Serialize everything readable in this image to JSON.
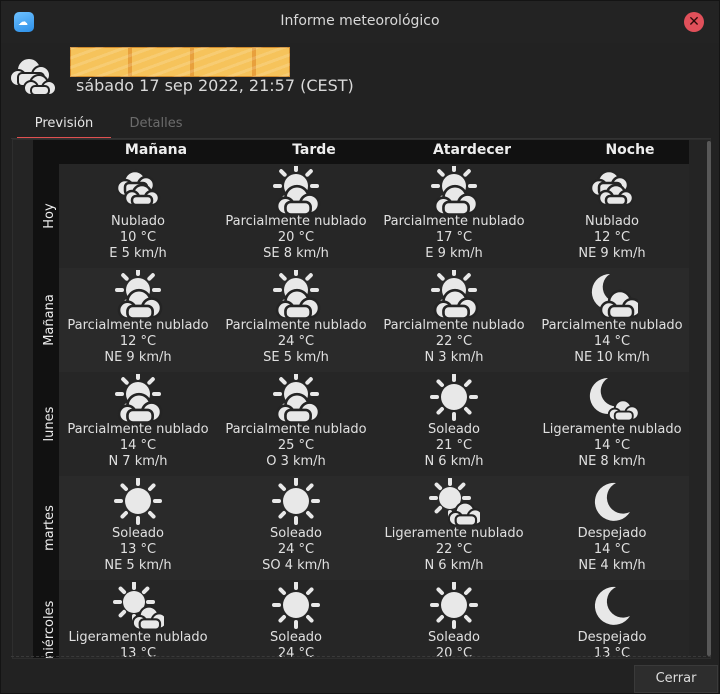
{
  "window": {
    "title": "Informe meteorológico",
    "close_symbol": "✕"
  },
  "header": {
    "datetime": "sábado 17 sep 2022, 21:57 (CEST)",
    "icon": "cloudy-icon"
  },
  "tabs": [
    {
      "label": "Previsión",
      "active": true
    },
    {
      "label": "Detalles",
      "active": false
    }
  ],
  "forecast": {
    "columns": [
      "Mañana",
      "Tarde",
      "Atardecer",
      "Noche"
    ],
    "rows": [
      {
        "label": "Hoy",
        "cells": [
          {
            "icon": "cloud",
            "cond": "Nublado",
            "temp": "10 °C",
            "wind": "E 5 km/h"
          },
          {
            "icon": "sun-cloud",
            "cond": "Parcialmente nublado",
            "temp": "20 °C",
            "wind": "SE 8 km/h"
          },
          {
            "icon": "sun-cloud",
            "cond": "Parcialmente nublado",
            "temp": "17 °C",
            "wind": "E 9 km/h"
          },
          {
            "icon": "cloud",
            "cond": "Nublado",
            "temp": "12 °C",
            "wind": "NE 9 km/h"
          }
        ]
      },
      {
        "label": "Mañana",
        "cells": [
          {
            "icon": "sun-cloud",
            "cond": "Parcialmente nublado",
            "temp": "12 °C",
            "wind": "NE 9 km/h"
          },
          {
            "icon": "sun-cloud",
            "cond": "Parcialmente nublado",
            "temp": "24 °C",
            "wind": "SE 5 km/h"
          },
          {
            "icon": "sun-cloud",
            "cond": "Parcialmente nublado",
            "temp": "22 °C",
            "wind": "N 3 km/h"
          },
          {
            "icon": "moon-cloud",
            "cond": "Parcialmente nublado",
            "temp": "14 °C",
            "wind": "NE 10 km/h"
          }
        ]
      },
      {
        "label": "lunes",
        "cells": [
          {
            "icon": "sun-cloud",
            "cond": "Parcialmente nublado",
            "temp": "14 °C",
            "wind": "N 7 km/h"
          },
          {
            "icon": "sun-cloud",
            "cond": "Parcialmente nublado",
            "temp": "25 °C",
            "wind": "O 3 km/h"
          },
          {
            "icon": "sun",
            "cond": "Soleado",
            "temp": "21 °C",
            "wind": "N 6 km/h"
          },
          {
            "icon": "moon-small-cloud",
            "cond": "Ligeramente nublado",
            "temp": "14 °C",
            "wind": "NE 8 km/h"
          }
        ]
      },
      {
        "label": "martes",
        "cells": [
          {
            "icon": "sun",
            "cond": "Soleado",
            "temp": "13 °C",
            "wind": "NE 5 km/h"
          },
          {
            "icon": "sun",
            "cond": "Soleado",
            "temp": "24 °C",
            "wind": "SO 4 km/h"
          },
          {
            "icon": "sun-small-cloud",
            "cond": "Ligeramente nublado",
            "temp": "22 °C",
            "wind": "N 6 km/h"
          },
          {
            "icon": "moon",
            "cond": "Despejado",
            "temp": "14 °C",
            "wind": "NE 4 km/h"
          }
        ]
      },
      {
        "label": "miércoles",
        "cells": [
          {
            "icon": "sun-small-cloud",
            "cond": "Ligeramente nublado",
            "temp": "13 °C",
            "wind": ""
          },
          {
            "icon": "sun",
            "cond": "Soleado",
            "temp": "24 °C",
            "wind": ""
          },
          {
            "icon": "sun",
            "cond": "Soleado",
            "temp": "20 °C",
            "wind": ""
          },
          {
            "icon": "moon",
            "cond": "Despejado",
            "temp": "13 °C",
            "wind": ""
          }
        ]
      }
    ]
  },
  "footer": {
    "close_label": "Cerrar"
  },
  "colors": {
    "background": "#222222",
    "row_alt": "#2a2a2a",
    "accent": "#e05050",
    "close_button": "#e0505a",
    "icon": "#e8e8e8"
  }
}
